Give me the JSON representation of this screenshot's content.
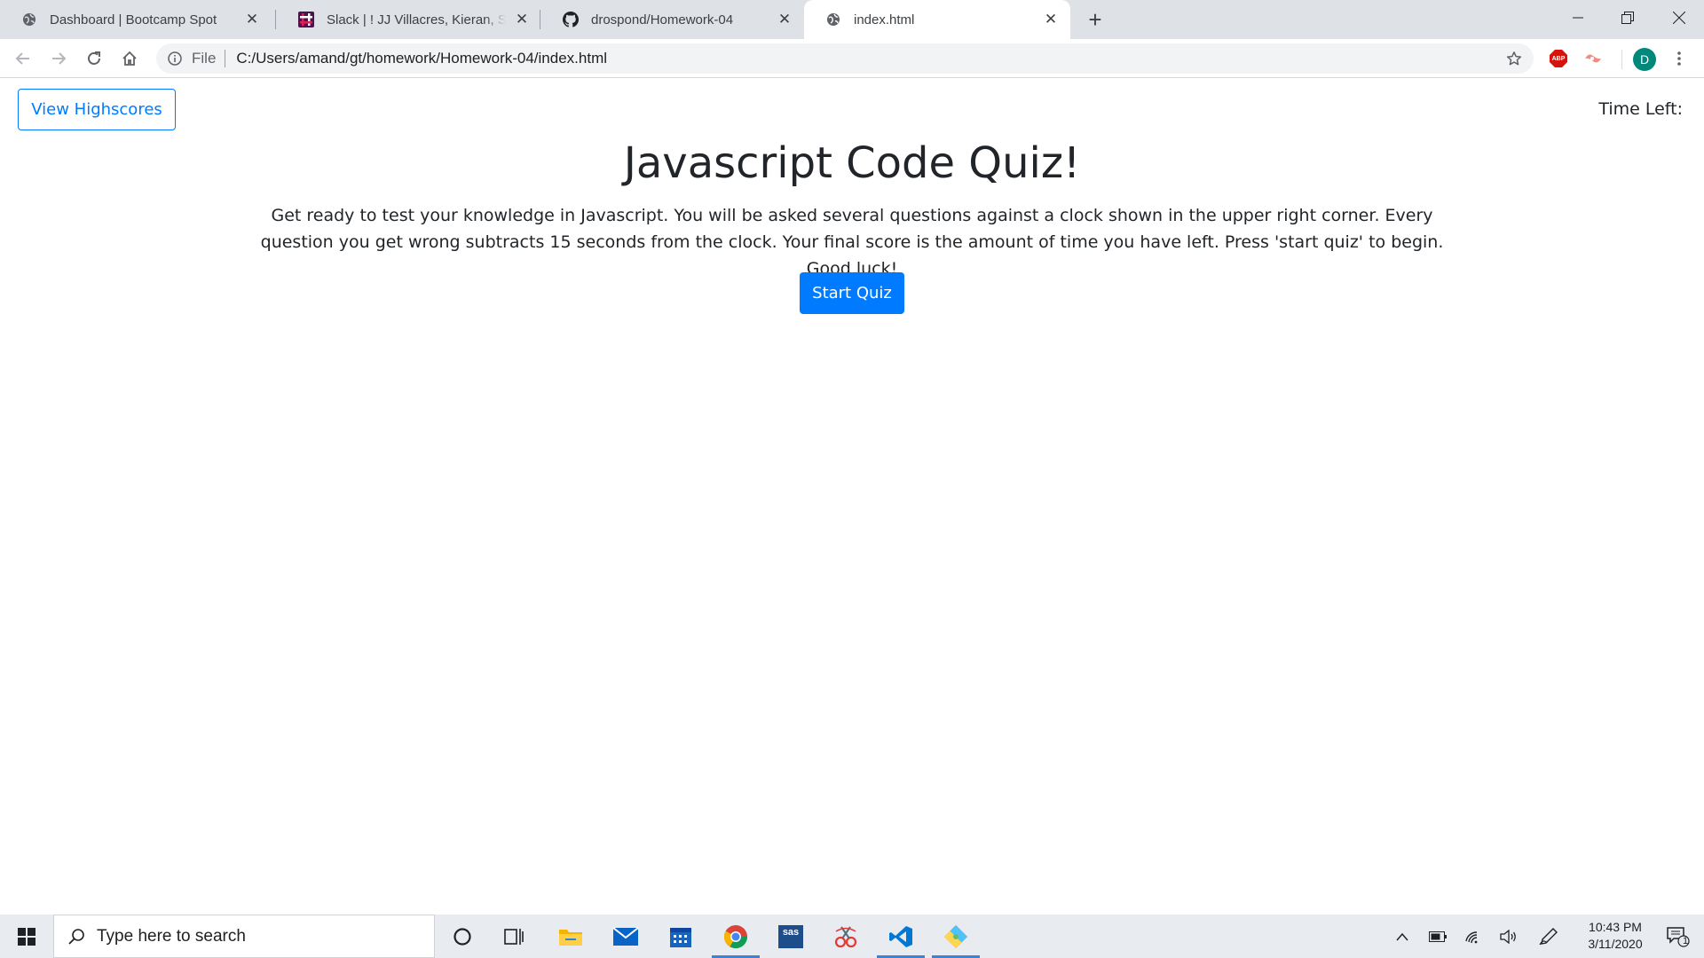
{
  "browser": {
    "tabs": [
      {
        "title": "Dashboard | Bootcamp Spot",
        "icon": "globe-icon",
        "active": false
      },
      {
        "title": "Slack | ! JJ Villacres, Kieran, Sam S",
        "icon": "slack-icon",
        "active": false
      },
      {
        "title": "drospond/Homework-04",
        "icon": "github-icon",
        "active": false
      },
      {
        "title": "index.html",
        "icon": "globe-icon",
        "active": true
      }
    ],
    "address": {
      "scheme_label": "File",
      "url": "C:/Users/amand/gt/homework/Homework-04/index.html"
    },
    "profile_initial": "D",
    "extension_label": "ABP"
  },
  "page": {
    "highscores_label": "View Highscores",
    "timer_label": "Time Left:",
    "timer_value": "",
    "title": "Javascript Code Quiz!",
    "description": "Get ready to test your knowledge in Javascript. You will be asked several questions against a clock shown in the upper right corner. Every question you get wrong subtracts 15 seconds from the clock. Your final score is the amount of time you have left. Press 'start quiz' to begin. Good luck!",
    "start_label": "Start Quiz"
  },
  "taskbar": {
    "search_placeholder": "Type here to search",
    "sas_label": "sas",
    "time": "10:43 PM",
    "date": "3/11/2020",
    "notification_count": "1",
    "apps": [
      "cortana-icon",
      "task-view-icon",
      "file-explorer-icon",
      "mail-icon",
      "calendar-icon",
      "chrome-icon",
      "sas-icon",
      "snipping-tool-icon",
      "vscode-icon",
      "git-icon"
    ]
  },
  "colors": {
    "primary": "#007bff",
    "text": "#212529",
    "tabstrip": "#dee1e6",
    "taskbar": "#e8ebef",
    "taskbar_running_indicator": "#3a83d6"
  }
}
